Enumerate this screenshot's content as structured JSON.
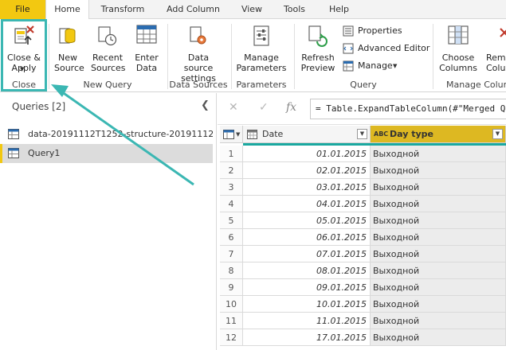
{
  "menu": {
    "tabs": [
      "File",
      "Home",
      "Transform",
      "Add Column",
      "View",
      "Tools",
      "Help"
    ]
  },
  "ribbon": {
    "close_apply": "Close & Apply",
    "close_group": "Close",
    "new_source": "New Source",
    "recent_sources": "Recent Sources",
    "enter_data": "Enter Data",
    "new_query_group": "New Query",
    "data_source_settings": "Data source settings",
    "data_sources_group": "Data Sources",
    "manage_parameters": "Manage Parameters",
    "parameters_group": "Parameters",
    "refresh_preview": "Refresh Preview",
    "properties": "Properties",
    "advanced_editor": "Advanced Editor",
    "manage": "Manage",
    "query_group": "Query",
    "choose_columns": "Choose Columns",
    "remove_columns": "Remove Columns",
    "manage_columns_group": "Manage Columns"
  },
  "queries": {
    "title": "Queries [2]",
    "items": [
      {
        "label": "data-20191112T1252-structure-20191112..."
      },
      {
        "label": "Query1"
      }
    ]
  },
  "formula": {
    "value": "= Table.ExpandTableColumn(#\"Merged Queries\""
  },
  "grid": {
    "columns": [
      "Date",
      "Day type"
    ],
    "type_abc": "ABC",
    "rows": [
      {
        "n": "1",
        "date": "01.01.2015",
        "type": "Выходной"
      },
      {
        "n": "2",
        "date": "02.01.2015",
        "type": "Выходной"
      },
      {
        "n": "3",
        "date": "03.01.2015",
        "type": "Выходной"
      },
      {
        "n": "4",
        "date": "04.01.2015",
        "type": "Выходной"
      },
      {
        "n": "5",
        "date": "05.01.2015",
        "type": "Выходной"
      },
      {
        "n": "6",
        "date": "06.01.2015",
        "type": "Выходной"
      },
      {
        "n": "7",
        "date": "07.01.2015",
        "type": "Выходной"
      },
      {
        "n": "8",
        "date": "08.01.2015",
        "type": "Выходной"
      },
      {
        "n": "9",
        "date": "09.01.2015",
        "type": "Выходной"
      },
      {
        "n": "10",
        "date": "10.01.2015",
        "type": "Выходной"
      },
      {
        "n": "11",
        "date": "11.01.2015",
        "type": "Выходной"
      },
      {
        "n": "12",
        "date": "17.01.2015",
        "type": "Выходной"
      }
    ]
  },
  "colors": {
    "accent_yellow": "#f2c811",
    "teal": "#3bb7b3"
  }
}
